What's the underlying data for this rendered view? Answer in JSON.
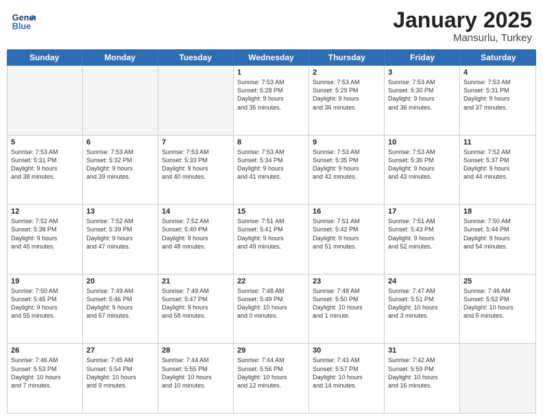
{
  "header": {
    "logo_line1": "General",
    "logo_line2": "Blue",
    "month_title": "January 2025",
    "location": "Mansurlu, Turkey"
  },
  "weekdays": [
    "Sunday",
    "Monday",
    "Tuesday",
    "Wednesday",
    "Thursday",
    "Friday",
    "Saturday"
  ],
  "rows": [
    [
      {
        "day": "",
        "info": ""
      },
      {
        "day": "",
        "info": ""
      },
      {
        "day": "",
        "info": ""
      },
      {
        "day": "1",
        "info": "Sunrise: 7:53 AM\nSunset: 5:28 PM\nDaylight: 9 hours\nand 35 minutes."
      },
      {
        "day": "2",
        "info": "Sunrise: 7:53 AM\nSunset: 5:29 PM\nDaylight: 9 hours\nand 36 minutes."
      },
      {
        "day": "3",
        "info": "Sunrise: 7:53 AM\nSunset: 5:30 PM\nDaylight: 9 hours\nand 36 minutes."
      },
      {
        "day": "4",
        "info": "Sunrise: 7:53 AM\nSunset: 5:31 PM\nDaylight: 9 hours\nand 37 minutes."
      }
    ],
    [
      {
        "day": "5",
        "info": "Sunrise: 7:53 AM\nSunset: 5:31 PM\nDaylight: 9 hours\nand 38 minutes."
      },
      {
        "day": "6",
        "info": "Sunrise: 7:53 AM\nSunset: 5:32 PM\nDaylight: 9 hours\nand 39 minutes."
      },
      {
        "day": "7",
        "info": "Sunrise: 7:53 AM\nSunset: 5:33 PM\nDaylight: 9 hours\nand 40 minutes."
      },
      {
        "day": "8",
        "info": "Sunrise: 7:53 AM\nSunset: 5:34 PM\nDaylight: 9 hours\nand 41 minutes."
      },
      {
        "day": "9",
        "info": "Sunrise: 7:53 AM\nSunset: 5:35 PM\nDaylight: 9 hours\nand 42 minutes."
      },
      {
        "day": "10",
        "info": "Sunrise: 7:53 AM\nSunset: 5:36 PM\nDaylight: 9 hours\nand 43 minutes."
      },
      {
        "day": "11",
        "info": "Sunrise: 7:52 AM\nSunset: 5:37 PM\nDaylight: 9 hours\nand 44 minutes."
      }
    ],
    [
      {
        "day": "12",
        "info": "Sunrise: 7:52 AM\nSunset: 5:38 PM\nDaylight: 9 hours\nand 45 minutes."
      },
      {
        "day": "13",
        "info": "Sunrise: 7:52 AM\nSunset: 5:39 PM\nDaylight: 9 hours\nand 47 minutes."
      },
      {
        "day": "14",
        "info": "Sunrise: 7:52 AM\nSunset: 5:40 PM\nDaylight: 9 hours\nand 48 minutes."
      },
      {
        "day": "15",
        "info": "Sunrise: 7:51 AM\nSunset: 5:41 PM\nDaylight: 9 hours\nand 49 minutes."
      },
      {
        "day": "16",
        "info": "Sunrise: 7:51 AM\nSunset: 5:42 PM\nDaylight: 9 hours\nand 51 minutes."
      },
      {
        "day": "17",
        "info": "Sunrise: 7:51 AM\nSunset: 5:43 PM\nDaylight: 9 hours\nand 52 minutes."
      },
      {
        "day": "18",
        "info": "Sunrise: 7:50 AM\nSunset: 5:44 PM\nDaylight: 9 hours\nand 54 minutes."
      }
    ],
    [
      {
        "day": "19",
        "info": "Sunrise: 7:50 AM\nSunset: 5:45 PM\nDaylight: 9 hours\nand 55 minutes."
      },
      {
        "day": "20",
        "info": "Sunrise: 7:49 AM\nSunset: 5:46 PM\nDaylight: 9 hours\nand 57 minutes."
      },
      {
        "day": "21",
        "info": "Sunrise: 7:49 AM\nSunset: 5:47 PM\nDaylight: 9 hours\nand 58 minutes."
      },
      {
        "day": "22",
        "info": "Sunrise: 7:48 AM\nSunset: 5:49 PM\nDaylight: 10 hours\nand 0 minutes."
      },
      {
        "day": "23",
        "info": "Sunrise: 7:48 AM\nSunset: 5:50 PM\nDaylight: 10 hours\nand 1 minute."
      },
      {
        "day": "24",
        "info": "Sunrise: 7:47 AM\nSunset: 5:51 PM\nDaylight: 10 hours\nand 3 minutes."
      },
      {
        "day": "25",
        "info": "Sunrise: 7:46 AM\nSunset: 5:52 PM\nDaylight: 10 hours\nand 5 minutes."
      }
    ],
    [
      {
        "day": "26",
        "info": "Sunrise: 7:46 AM\nSunset: 5:53 PM\nDaylight: 10 hours\nand 7 minutes."
      },
      {
        "day": "27",
        "info": "Sunrise: 7:45 AM\nSunset: 5:54 PM\nDaylight: 10 hours\nand 9 minutes."
      },
      {
        "day": "28",
        "info": "Sunrise: 7:44 AM\nSunset: 5:55 PM\nDaylight: 10 hours\nand 10 minutes."
      },
      {
        "day": "29",
        "info": "Sunrise: 7:44 AM\nSunset: 5:56 PM\nDaylight: 10 hours\nand 12 minutes."
      },
      {
        "day": "30",
        "info": "Sunrise: 7:43 AM\nSunset: 5:57 PM\nDaylight: 10 hours\nand 14 minutes."
      },
      {
        "day": "31",
        "info": "Sunrise: 7:42 AM\nSunset: 5:59 PM\nDaylight: 10 hours\nand 16 minutes."
      },
      {
        "day": "",
        "info": ""
      }
    ]
  ]
}
